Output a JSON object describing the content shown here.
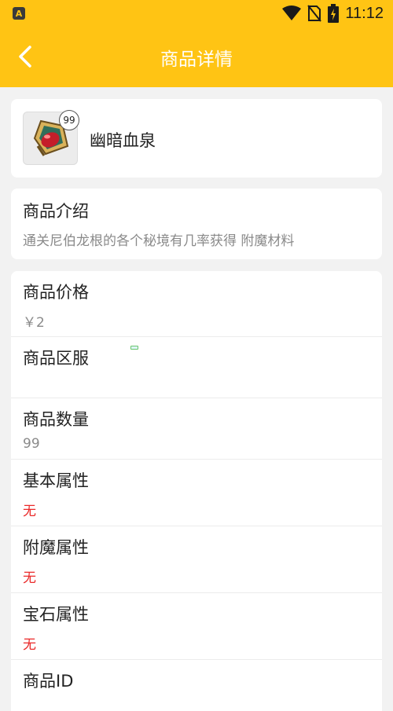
{
  "status_bar": {
    "app_badge": "A",
    "time": "11:12",
    "icons": [
      "wifi-icon",
      "no-sim-icon",
      "battery-charging-icon"
    ]
  },
  "toolbar": {
    "title": "商品详情",
    "back_icon": "chevron-left-icon"
  },
  "item": {
    "name": "幽暗血泉",
    "quantity_badge": "99"
  },
  "description": {
    "title": "商品介绍",
    "text": "通关尼伯龙根的各个秘境有几率获得 附魔材料"
  },
  "properties": [
    {
      "label": "商品价格",
      "value": "￥2"
    },
    {
      "label": "商品区服",
      "value": ""
    },
    {
      "label": "商品数量",
      "value": "99"
    },
    {
      "label": "基本属性",
      "value": "无"
    },
    {
      "label": "附魔属性",
      "value": "无"
    },
    {
      "label": "宝石属性",
      "value": "无"
    },
    {
      "label": "商品ID",
      "value": ""
    }
  ],
  "colors": {
    "accent": "#ffc414",
    "value_red": "#ea2a2a",
    "value_gray": "#8a8a8a"
  }
}
